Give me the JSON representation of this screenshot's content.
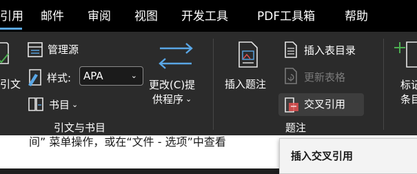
{
  "tabs": [
    {
      "label": "引用",
      "active": true
    },
    {
      "label": "邮件"
    },
    {
      "label": "审阅"
    },
    {
      "label": "视图"
    },
    {
      "label": "开发工具"
    },
    {
      "label": "PDF工具箱"
    },
    {
      "label": "帮助"
    }
  ],
  "ribbon": {
    "citations_group": {
      "insert_citation_label": "引文",
      "manage_sources_label": "管理源",
      "style_label": "样式:",
      "style_value": "APA",
      "bibliography_label": "书目",
      "group_label": "引文与书目"
    },
    "update_group": {
      "change_label_line1": "更改(C)提",
      "change_label_line2": "供程序"
    },
    "captions_group": {
      "insert_caption_label": "插入题注",
      "insert_table_of_figures_label": "插入表目录",
      "update_table_label": "更新表格",
      "cross_reference_label": "交叉引用",
      "group_label": "题注"
    },
    "index_group": {
      "mark_entry_line1": "标记",
      "mark_entry_line2": "条目"
    }
  },
  "document": {
    "visible_text": "间” 菜单操作，或在“文件 - 选项”中查看"
  },
  "tooltip": {
    "title": "插入交叉引用"
  },
  "colors": {
    "tab_bar": "#000000",
    "ribbon": "#2b2b2b",
    "accent_blue": "#5aa7e6",
    "accent_green": "#4caf50",
    "accent_red": "#e05050"
  }
}
